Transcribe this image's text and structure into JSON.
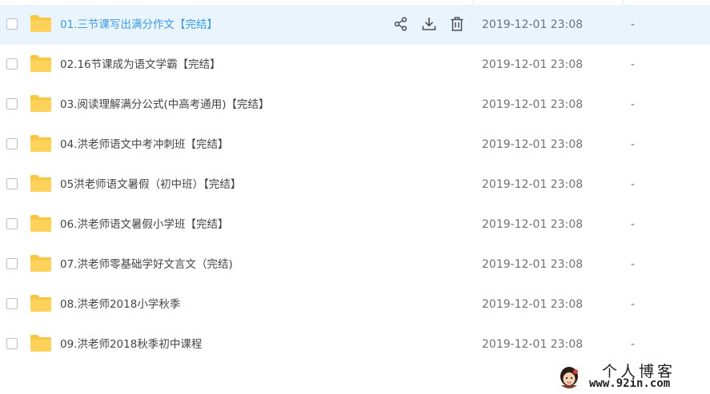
{
  "files": [
    {
      "name": "01.三节课写出满分作文【完结】",
      "date": "2019-12-01 23:08",
      "size": "-",
      "active": true
    },
    {
      "name": "02.16节课成为语文学霸【完结】",
      "date": "2019-12-01 23:08",
      "size": "-"
    },
    {
      "name": "03.阅读理解满分公式(中高考通用)【完结】",
      "date": "2019-12-01 23:08",
      "size": "-"
    },
    {
      "name": "04.洪老师语文中考冲刺班【完结】",
      "date": "2019-12-01 23:08",
      "size": "-"
    },
    {
      "name": "05洪老师语文暑假（初中班）【完结】",
      "date": "2019-12-01 23:08",
      "size": "-"
    },
    {
      "name": "06.洪老师语文暑假小学班【完结】",
      "date": "2019-12-01 23:08",
      "size": "-"
    },
    {
      "name": "07.洪老师零基础学好文言文（完结)",
      "date": "2019-12-01 23:08",
      "size": "-"
    },
    {
      "name": "08.洪老师2018小学秋季",
      "date": "2019-12-01 23:08",
      "size": "-"
    },
    {
      "name": "09.洪老师2018秋季初中课程",
      "date": "2019-12-01 23:08",
      "size": "-"
    }
  ],
  "row_actions": [
    "share-icon",
    "download-icon",
    "delete-icon"
  ],
  "watermark": {
    "title": "个人博客",
    "url": "www.92in.com"
  },
  "colors": {
    "accent": "#3a9bf1",
    "active_row": "#eaf4fd",
    "folder": "#f9c640",
    "icon": "#4b4e55"
  }
}
